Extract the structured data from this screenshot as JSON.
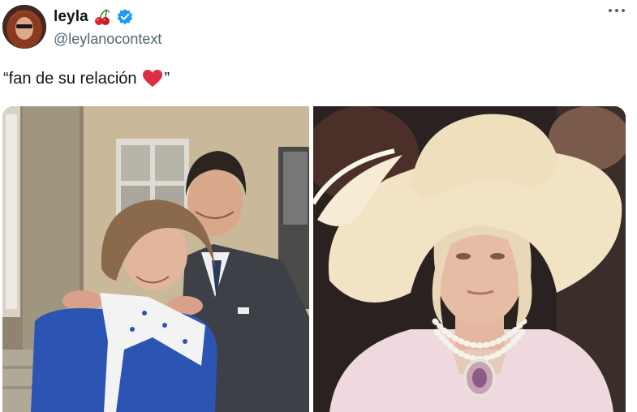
{
  "tweet": {
    "display_name": "leyla",
    "handle": "@leylanocontext",
    "text": "“fan de su relación",
    "text_end": "”"
  },
  "icons": {
    "name_emoji": "cherries-icon",
    "verified": "verified-badge-icon",
    "more": "more-options-icon",
    "heart": "red-heart-icon"
  },
  "media": {
    "left_image": "couple-photo",
    "right_image": "woman-in-hat-photo"
  },
  "colors": {
    "verified_blue": "#1d9bf0",
    "handle_gray": "#536471",
    "heart_red": "#dd2e44"
  }
}
